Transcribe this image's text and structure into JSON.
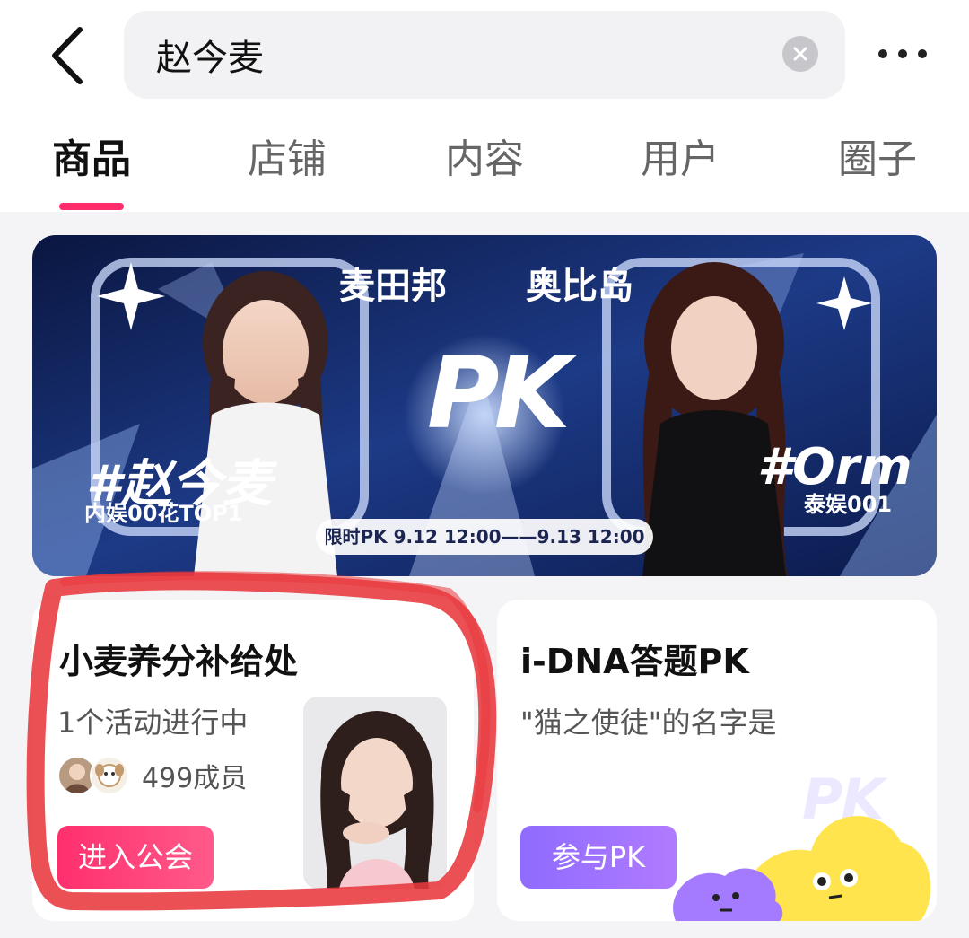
{
  "search": {
    "query": "赵今麦"
  },
  "tabs": [
    {
      "label": "商品",
      "active": true
    },
    {
      "label": "店铺",
      "active": false
    },
    {
      "label": "内容",
      "active": false
    },
    {
      "label": "用户",
      "active": false
    },
    {
      "label": "圈子",
      "active": false
    }
  ],
  "banner": {
    "team_left": "麦田邦",
    "team_right": "奥比岛",
    "pk_mark": "PK",
    "tag_left": "#赵今麦",
    "sub_left": "内娱00花TOP1",
    "tag_right": "#Orm",
    "sub_right": "泰娱001",
    "time": "限时PK 9.12 12:00——9.13 12:00"
  },
  "guild_card": {
    "title": "小麦养分补给处",
    "activity": "1个活动进行中",
    "members": "499成员",
    "join_label": "进入公会"
  },
  "quiz_card": {
    "title": "i-DNA答题PK",
    "question": "\"猫之使徒\"的名字是",
    "watermark": "PK",
    "join_label": "参与PK"
  },
  "colors": {
    "accent": "#ff2d6b",
    "join_button": "#ff2f6d",
    "pk_button": "#9b6dff",
    "annotation": "#e8383d",
    "banner_bg": "#0e1d4a"
  },
  "icons": [
    "back-arrow-icon",
    "clear-icon",
    "more-icon"
  ]
}
